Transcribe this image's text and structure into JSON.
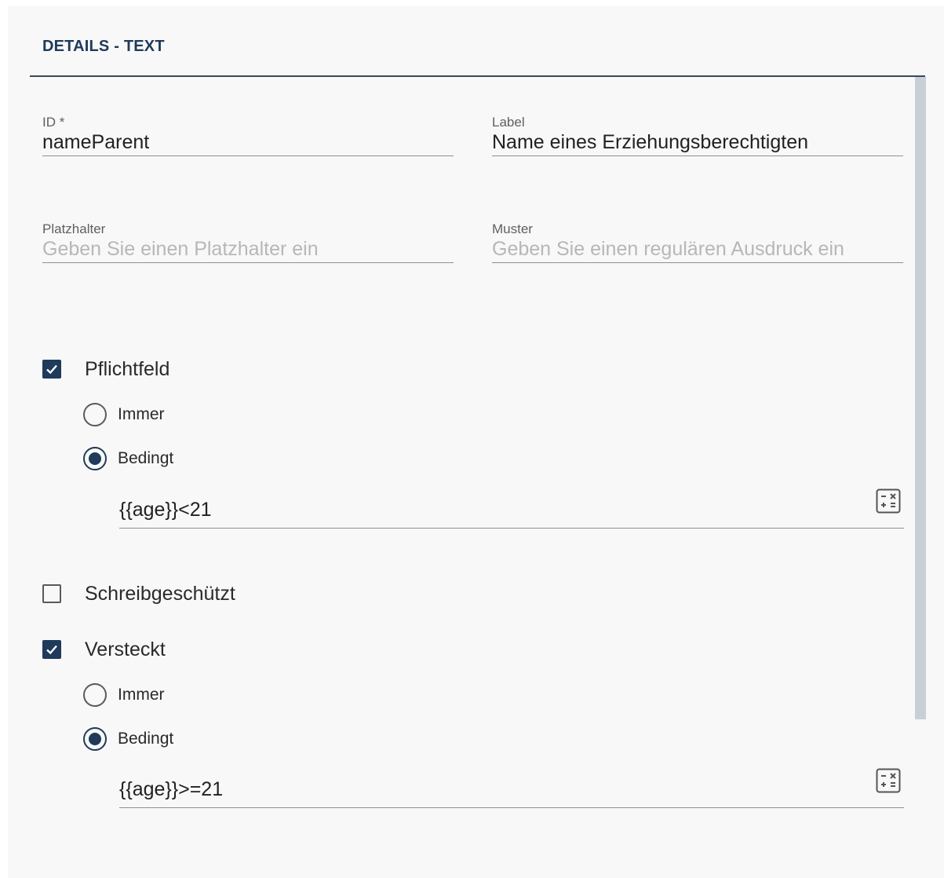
{
  "panel": {
    "title": "DETAILS - TEXT"
  },
  "fields": {
    "id": {
      "label": "ID *",
      "value": "nameParent"
    },
    "label": {
      "label": "Label",
      "value": "Name eines Erziehungsberechtigten"
    },
    "placeholder": {
      "label": "Platzhalter",
      "placeholder": "Geben Sie einen Platzhalter ein"
    },
    "pattern": {
      "label": "Muster",
      "placeholder": "Geben Sie einen regulären Ausdruck ein"
    }
  },
  "required": {
    "label": "Pflichtfeld",
    "checked": true,
    "options": [
      {
        "label": "Immer",
        "selected": false
      },
      {
        "label": "Bedingt",
        "selected": true
      }
    ],
    "expression": "{{age}}<21"
  },
  "readonly": {
    "label": "Schreibgeschützt",
    "checked": false
  },
  "hidden": {
    "label": "Versteckt",
    "checked": true,
    "options": [
      {
        "label": "Immer",
        "selected": false
      },
      {
        "label": "Bedingt",
        "selected": true
      }
    ],
    "expression": "{{age}}>=21"
  },
  "icons": {
    "checkmark": "check-icon",
    "calculator": "calculator-icon"
  },
  "colors": {
    "accent": "#1f3a5a",
    "scrollbar": "#c9cfd6",
    "background": "#f8f8f8"
  }
}
